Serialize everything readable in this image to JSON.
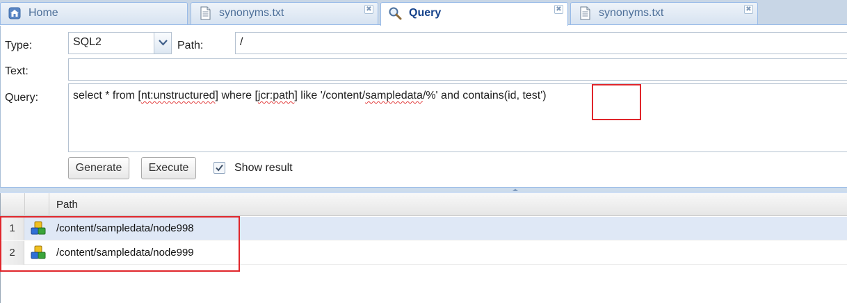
{
  "tabs": [
    {
      "label": "Home",
      "icon": "home-icon",
      "closable": false
    },
    {
      "label": "synonyms.txt",
      "icon": "file-icon",
      "closable": true
    },
    {
      "label": "Query",
      "icon": "magnifier-icon",
      "closable": true,
      "active": true
    },
    {
      "label": "synonyms.txt",
      "icon": "file-icon",
      "closable": true
    }
  ],
  "tab_close_glyph": "✖",
  "form": {
    "type_label": "Type:",
    "type_value": "SQL2",
    "path_label": "Path:",
    "path_value": "/",
    "text_label": "Text:",
    "text_value": "",
    "query_label": "Query:",
    "query_parts": {
      "p1": "select * from [",
      "p2": "nt:unstructured",
      "p3": "] where [",
      "p4": "jcr:path",
      "p5": "] like '/content/",
      "p6": "sampledata",
      "p7": "/%' and contains(id, test')"
    },
    "generate_label": "Generate",
    "execute_label": "Execute",
    "show_result_label": "Show result",
    "show_result_checked": true
  },
  "grid": {
    "columns": [
      "Path"
    ],
    "rows": [
      {
        "num": "1",
        "path": "/content/sampledata/node998",
        "icon": "node-icon",
        "selected": true
      },
      {
        "num": "2",
        "path": "/content/sampledata/node999",
        "icon": "node-icon",
        "selected": false
      }
    ]
  },
  "colors": {
    "accent_header": "#15428b",
    "tab_border": "#99bbe8",
    "selected_row": "#dfe8f6",
    "annotation": "#e0262b"
  }
}
